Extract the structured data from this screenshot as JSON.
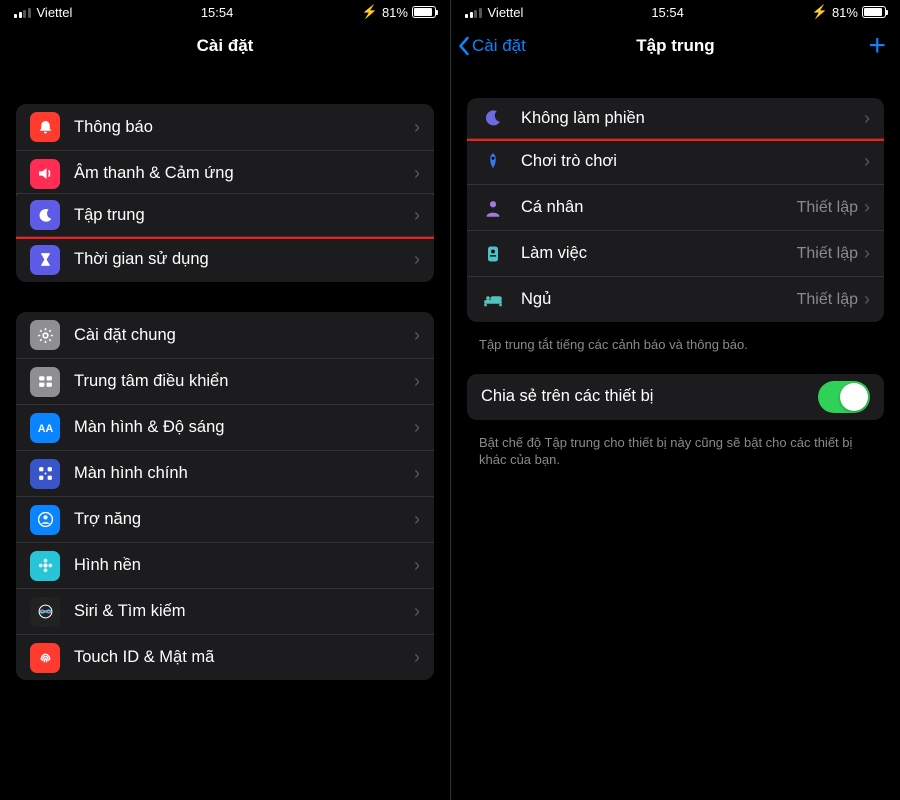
{
  "status": {
    "carrier": "Viettel",
    "time": "15:54",
    "battery_pct": "81%"
  },
  "left": {
    "title": "Cài đặt",
    "groups": [
      {
        "rows": [
          {
            "icon_bg": "#ff3b30",
            "icon_name": "bell-badge-icon",
            "glyph": "bell",
            "label": "Thông báo"
          },
          {
            "icon_bg": "#ff2d55",
            "icon_name": "speaker-icon",
            "glyph": "speaker",
            "label": "Âm thanh & Cảm ứng"
          },
          {
            "icon_bg": "#5e5ce6",
            "icon_name": "moon-icon",
            "glyph": "moon",
            "label": "Tập trung",
            "highlight": true
          },
          {
            "icon_bg": "#5e5ce6",
            "icon_name": "hourglass-icon",
            "glyph": "hourglass",
            "label": "Thời gian sử dụng"
          }
        ]
      },
      {
        "rows": [
          {
            "icon_bg": "#8e8e93",
            "icon_name": "gear-icon",
            "glyph": "gear",
            "label": "Cài đặt chung"
          },
          {
            "icon_bg": "#8e8e93",
            "icon_name": "control-center-icon",
            "glyph": "sliders",
            "label": "Trung tâm điều khiển"
          },
          {
            "icon_bg": "#0a84ff",
            "icon_name": "display-icon",
            "glyph": "aa",
            "label": "Màn hình & Độ sáng"
          },
          {
            "icon_bg": "#3a55c9",
            "icon_name": "home-screen-icon",
            "glyph": "grid",
            "label": "Màn hình chính"
          },
          {
            "icon_bg": "#0a84ff",
            "icon_name": "accessibility-icon",
            "glyph": "person-circle",
            "label": "Trợ năng"
          },
          {
            "icon_bg": "#28c4d8",
            "icon_name": "wallpaper-icon",
            "glyph": "flower",
            "label": "Hình nền"
          },
          {
            "icon_bg": "#222",
            "icon_name": "siri-icon",
            "glyph": "siri",
            "label": "Siri & Tìm kiếm"
          },
          {
            "icon_bg": "#ff3b30",
            "icon_name": "touchid-icon",
            "glyph": "fingerprint",
            "label": "Touch ID & Mật mã"
          }
        ]
      }
    ]
  },
  "right": {
    "back_label": "Cài đặt",
    "title": "Tập trung",
    "focus_rows": [
      {
        "icon_name": "moon-icon",
        "glyph": "moon",
        "color": "#6e6be0",
        "label": "Không làm phiền",
        "detail": "",
        "highlight": true
      },
      {
        "icon_name": "rocket-icon",
        "glyph": "rocket",
        "color": "#3478f6",
        "label": "Chơi trò chơi",
        "detail": ""
      },
      {
        "icon_name": "person-icon",
        "glyph": "person",
        "color": "#a17ae0",
        "label": "Cá nhân",
        "detail": "Thiết lập"
      },
      {
        "icon_name": "badge-icon",
        "glyph": "badge",
        "color": "#4fc1c9",
        "label": "Làm việc",
        "detail": "Thiết lập"
      },
      {
        "icon_name": "bed-icon",
        "glyph": "bed",
        "color": "#52c1bb",
        "label": "Ngủ",
        "detail": "Thiết lập"
      }
    ],
    "group_footer": "Tập trung tắt tiếng các cảnh báo và thông báo.",
    "share_row_label": "Chia sẻ trên các thiết bị",
    "share_toggle_on": true,
    "share_footer": "Bật chế độ Tập trung cho thiết bị này cũng sẽ bật cho các thiết bị khác của bạn."
  }
}
